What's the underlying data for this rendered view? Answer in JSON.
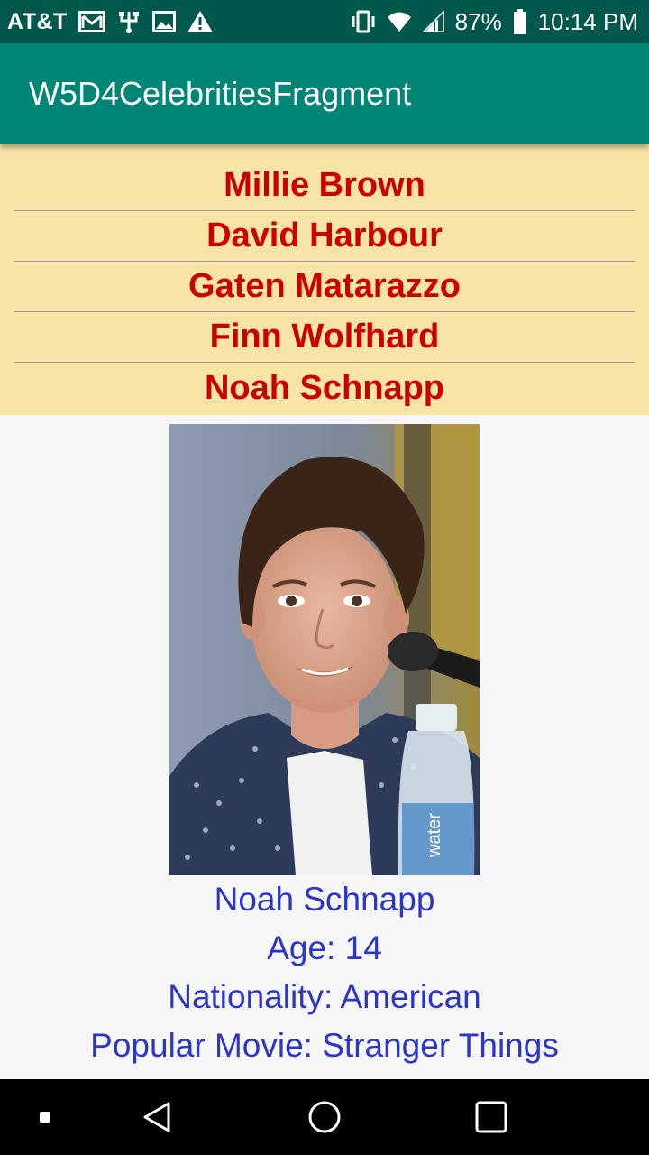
{
  "status_bar": {
    "carrier": "AT&T",
    "battery": "87%",
    "time": "10:14 PM",
    "icons": [
      "gmail-icon",
      "usb-icon",
      "image-icon",
      "warning-icon",
      "vibrate-icon",
      "wifi-icon",
      "signal-icon",
      "battery-icon"
    ]
  },
  "app_bar": {
    "title": "W5D4CelebritiesFragment",
    "color": "#008577"
  },
  "list": {
    "background": "#f7e4a6",
    "item_color": "#cc0000",
    "items": [
      "Millie Brown",
      "David Harbour",
      "Gaten Matarazzo",
      "Finn Wolfhard",
      "Noah Schnapp"
    ]
  },
  "detail": {
    "photo": "celebrity-photo",
    "name": "Noah Schnapp",
    "age": "Age: 14",
    "nationality": "Nationality: American",
    "movie": "Popular Movie: Stranger Things",
    "text_color": "#2b35c8"
  },
  "nav_bar": {
    "buttons": [
      "recents-square-icon",
      "back-icon",
      "home-icon",
      "overview-icon"
    ]
  }
}
